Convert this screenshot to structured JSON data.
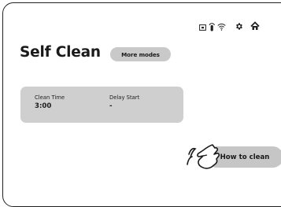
{
  "status_bar": {
    "icons": [
      "remote-control-icon",
      "tap-icon",
      "wifi-icon",
      "settings-icon",
      "home-icon"
    ]
  },
  "page": {
    "title": "Self Clean",
    "more_modes_label": "More modes"
  },
  "info_card": {
    "fields": [
      {
        "label": "Clean Time",
        "value": "3:00"
      },
      {
        "label": "Delay Start",
        "value": "-"
      }
    ]
  },
  "how_to_clean_label": "How to clean",
  "colors": {
    "background": "#ffffff",
    "button": "#c9c9c9",
    "card": "#cfcfcf",
    "text": "#1a1a1a"
  }
}
